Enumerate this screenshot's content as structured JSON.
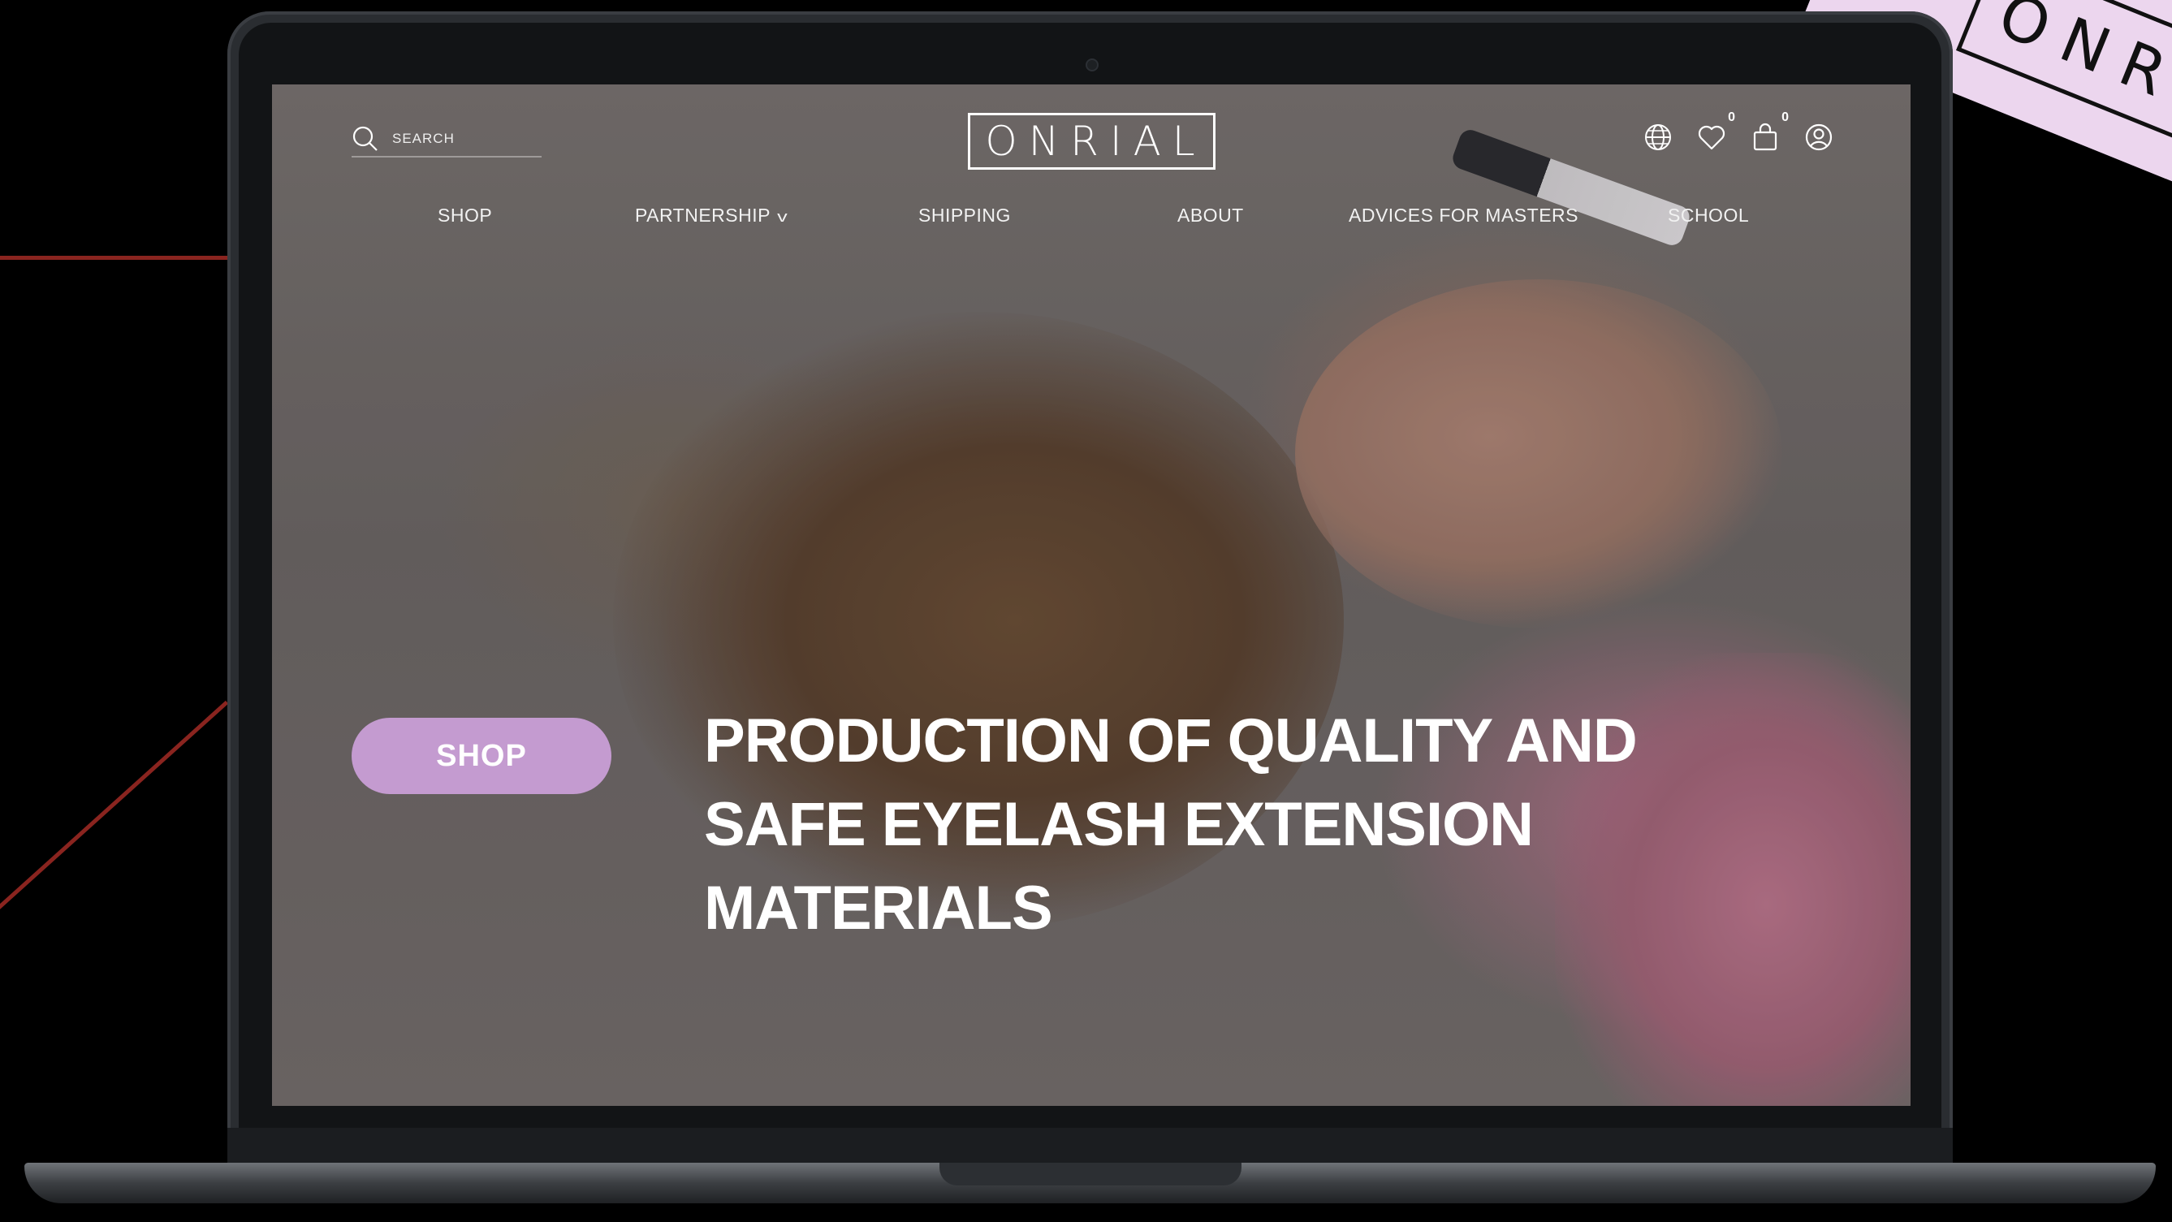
{
  "header": {
    "search_placeholder": "SEARCH",
    "logo_text": "ONRIAL",
    "wishlist_count": "0",
    "cart_count": "0"
  },
  "nav": {
    "items": [
      {
        "label": "SHOP"
      },
      {
        "label": "PARTNERSHIP"
      },
      {
        "label": "SHIPPING"
      },
      {
        "label": "ABOUT"
      },
      {
        "label": "ADVICES FOR MASTERS"
      },
      {
        "label": "SCHOOL"
      }
    ]
  },
  "hero": {
    "button_label": "SHOP",
    "headline_lines": [
      "PRODUCTION OF QUALITY AND",
      "SAFE EYELASH EXTENSION",
      "MATERIALS"
    ]
  },
  "sticker": {
    "text": "ONRIA"
  },
  "colors": {
    "accent": "#c49bd0",
    "sticker": "#ecd6ee",
    "line": "#8a241f"
  }
}
